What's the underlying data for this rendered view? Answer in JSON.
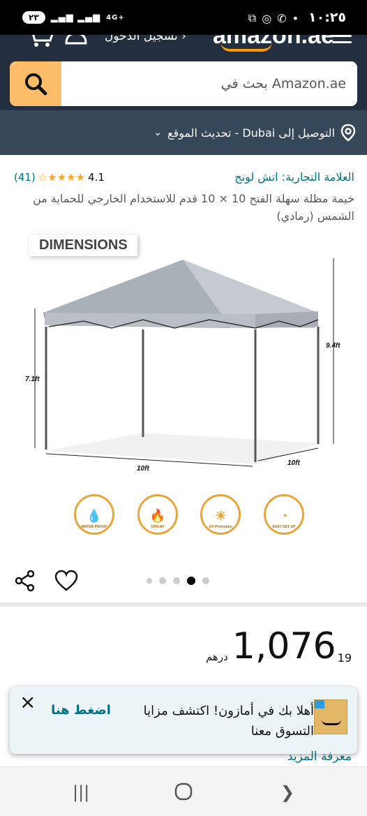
{
  "status_bar": {
    "time": "١٠:٢٥",
    "battery": "٢٣",
    "network": "4G+"
  },
  "header": {
    "logo_text": "amazon.ae",
    "signin_label": "تسجيل الدخول ›"
  },
  "search": {
    "placeholder": "بحث في Amazon.ae"
  },
  "delivery": {
    "text": "التوصيل إلى Dubai - تحديث الموقع"
  },
  "product": {
    "brand": "العلامة التجارية: اتش لونج",
    "rating_value": "4.1",
    "stars": 4.5,
    "rating_count": "(41)",
    "title": "خيمة مظلة سهلة الفتح 10 × 10 قدم للاستخدام الخارجي للحماية من الشمس (رمادي)"
  },
  "image": {
    "badge": "DIMENSIONS",
    "height_left": "7.1ft",
    "height_right": "9.4ft",
    "width_front": "10ft",
    "width_side": "10ft",
    "features": [
      {
        "icon": "water-drop-icon",
        "label": "WATER PROOF"
      },
      {
        "icon": "flame-icon",
        "label": "CPAI-84"
      },
      {
        "icon": "sun-icon",
        "label": "UV Protection"
      },
      {
        "icon": "clock-icon",
        "label": "EASY SET UP"
      }
    ],
    "carousel_total": 5,
    "carousel_active": 4
  },
  "price": {
    "currency": "درهم",
    "whole": "1,076",
    "fraction": "19"
  },
  "popup": {
    "text": "أهلا بك في أمازون! اكتشف مزايا التسوق معنا",
    "cta": "اضغط هنا",
    "close": "×"
  },
  "learn_more": "معرفة المزيد"
}
